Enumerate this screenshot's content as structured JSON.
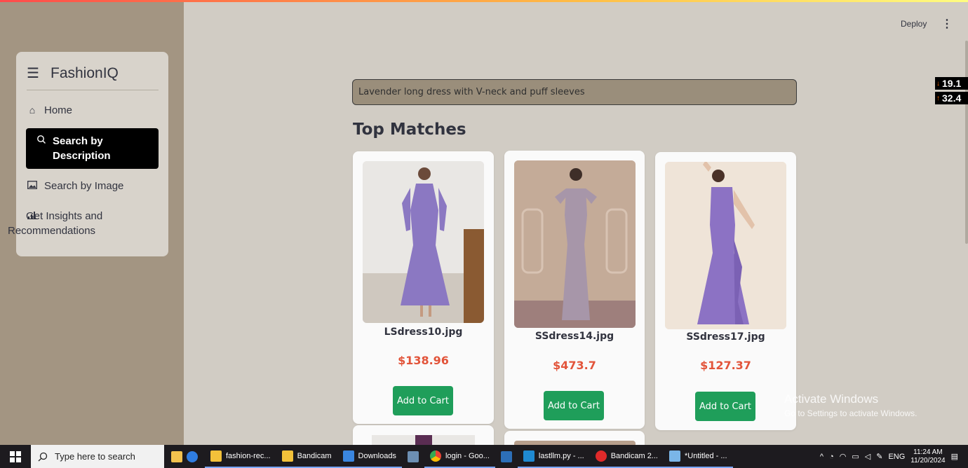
{
  "app": {
    "brand": "FashionIQ",
    "deploy_label": "Deploy"
  },
  "sidebar": {
    "items": [
      {
        "label": "Home",
        "icon": "home-icon"
      },
      {
        "label": "Search by Description",
        "icon": "search-icon",
        "active": true
      },
      {
        "label": "Search by Image",
        "icon": "image-icon"
      },
      {
        "label": "Get Insights and Recommendations",
        "icon": "bar-chart-icon"
      }
    ]
  },
  "overlay_badges": [
    {
      "value": "19.1"
    },
    {
      "value": "32.4"
    }
  ],
  "search": {
    "value": "Lavender long dress with V-neck and puff sleeves"
  },
  "results": {
    "title": "Top Matches",
    "cards": [
      {
        "filename": "LSdress10.jpg",
        "price": "$138.96",
        "button": "Add to Cart"
      },
      {
        "filename": "SSdress14.jpg",
        "price": "$473.7",
        "button": "Add to Cart"
      },
      {
        "filename": "SSdress17.jpg",
        "price": "$127.37",
        "button": "Add to Cart"
      }
    ]
  },
  "watermark": {
    "line1": "Activate Windows",
    "line2": "Go to Settings to activate Windows."
  },
  "taskbar": {
    "search_placeholder": "Type here to search",
    "apps": [
      {
        "label": "fashion-rec..."
      },
      {
        "label": "Bandicam"
      },
      {
        "label": "Downloads"
      },
      {
        "label": "login - Goo..."
      },
      {
        "label": "lastllm.py - ..."
      },
      {
        "label": "Bandicam 2..."
      },
      {
        "label": "*Untitled - ..."
      }
    ],
    "lang": "ENG",
    "time": "11:24 AM",
    "date": "11/20/2024"
  },
  "colors": {
    "accent_button": "#1f9e5a",
    "price": "#e2543a",
    "sidebar_bg": "#a39582",
    "main_bg": "#d1ccc4"
  }
}
